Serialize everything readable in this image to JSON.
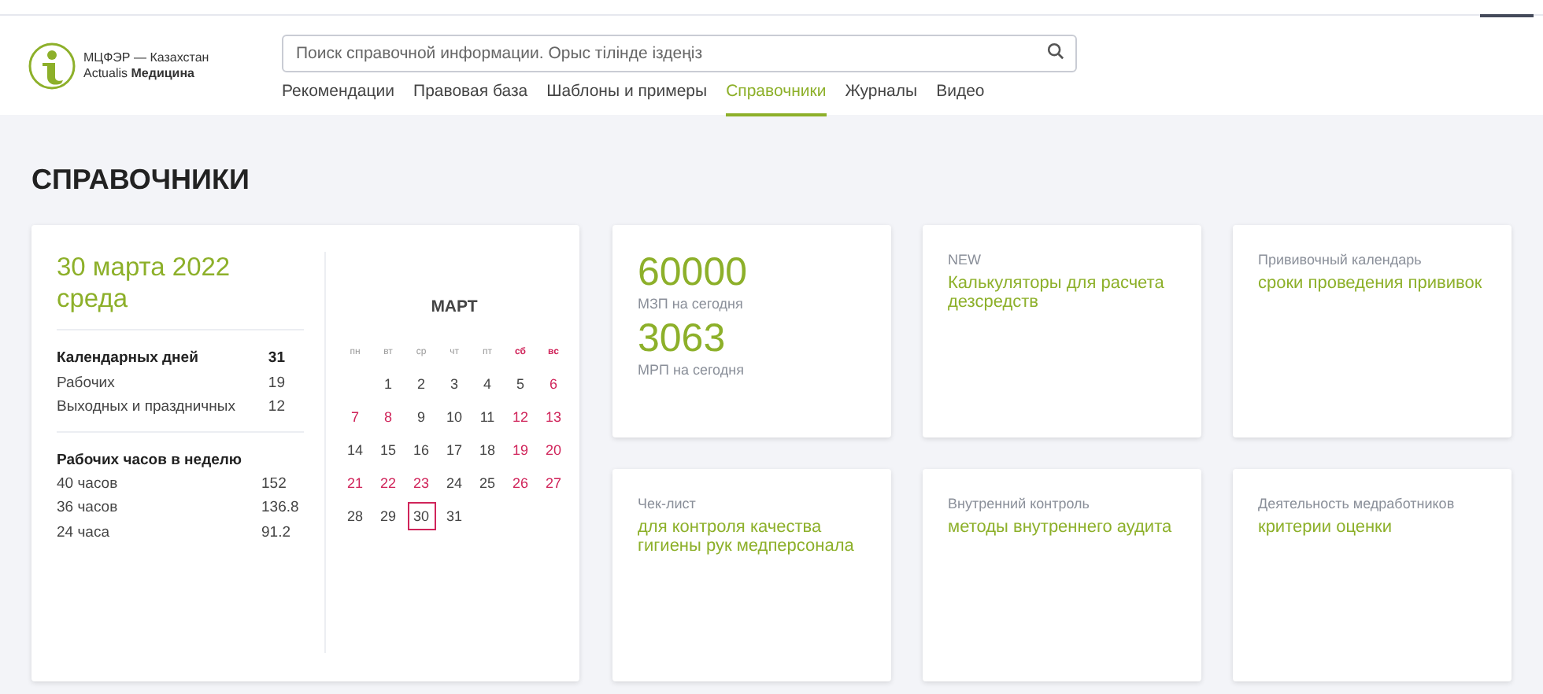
{
  "logo": {
    "line1": "МЦФЭР — Казахстан",
    "line2_prefix": "Actualis",
    "line2_bold": "Медицина"
  },
  "search": {
    "placeholder": "Поиск справочной информации. Орыс тілінде іздеңіз"
  },
  "nav": [
    {
      "label": "Рекомендации",
      "selected": false
    },
    {
      "label": "Правовая база",
      "selected": false
    },
    {
      "label": "Шаблоны и примеры",
      "selected": false
    },
    {
      "label": "Справочники",
      "selected": true
    },
    {
      "label": "Журналы",
      "selected": false
    },
    {
      "label": "Видео",
      "selected": false
    }
  ],
  "page_title": "СПРАВОЧНИКИ",
  "calendar_card": {
    "date": "30 марта 2022",
    "weekday": "среда",
    "days_stats": [
      {
        "label": "Календарных дней",
        "value": "31",
        "bold": true
      },
      {
        "label": "Рабочих",
        "value": "19",
        "bold": false
      },
      {
        "label": "Выходных и праздничных",
        "value": "12",
        "bold": false
      }
    ],
    "hours_title": "Рабочих часов в неделю",
    "hours_stats": [
      {
        "label": "40 часов",
        "value": "152"
      },
      {
        "label": "36 часов",
        "value": "136.8"
      },
      {
        "label": "24 часа",
        "value": "91.2"
      }
    ],
    "month": "МАРТ",
    "weekdays": [
      {
        "label": "пн",
        "holiday": false
      },
      {
        "label": "вт",
        "holiday": false
      },
      {
        "label": "ср",
        "holiday": false
      },
      {
        "label": "чт",
        "holiday": false
      },
      {
        "label": "пт",
        "holiday": false
      },
      {
        "label": "сб",
        "holiday": true
      },
      {
        "label": "вс",
        "holiday": true
      }
    ],
    "weeks": [
      [
        {
          "kind": "blank"
        },
        {
          "kind": "day",
          "day": "1",
          "holiday": false,
          "selected": false
        },
        {
          "kind": "day",
          "day": "2",
          "holiday": false,
          "selected": false
        },
        {
          "kind": "day",
          "day": "3",
          "holiday": false,
          "selected": false
        },
        {
          "kind": "day",
          "day": "4",
          "holiday": false,
          "selected": false
        },
        {
          "kind": "day",
          "day": "5",
          "holiday": false,
          "selected": false
        },
        {
          "kind": "day",
          "day": "6",
          "holiday": true,
          "selected": false
        }
      ],
      [
        {
          "kind": "day",
          "day": "7",
          "holiday": true,
          "selected": false
        },
        {
          "kind": "day",
          "day": "8",
          "holiday": true,
          "selected": false
        },
        {
          "kind": "day",
          "day": "9",
          "holiday": false,
          "selected": false
        },
        {
          "kind": "day",
          "day": "10",
          "holiday": false,
          "selected": false
        },
        {
          "kind": "day",
          "day": "11",
          "holiday": false,
          "selected": false
        },
        {
          "kind": "day",
          "day": "12",
          "holiday": true,
          "selected": false
        },
        {
          "kind": "day",
          "day": "13",
          "holiday": true,
          "selected": false
        }
      ],
      [
        {
          "kind": "day",
          "day": "14",
          "holiday": false,
          "selected": false
        },
        {
          "kind": "day",
          "day": "15",
          "holiday": false,
          "selected": false
        },
        {
          "kind": "day",
          "day": "16",
          "holiday": false,
          "selected": false
        },
        {
          "kind": "day",
          "day": "17",
          "holiday": false,
          "selected": false
        },
        {
          "kind": "day",
          "day": "18",
          "holiday": false,
          "selected": false
        },
        {
          "kind": "day",
          "day": "19",
          "holiday": true,
          "selected": false
        },
        {
          "kind": "day",
          "day": "20",
          "holiday": true,
          "selected": false
        }
      ],
      [
        {
          "kind": "day",
          "day": "21",
          "holiday": true,
          "selected": false
        },
        {
          "kind": "day",
          "day": "22",
          "holiday": true,
          "selected": false
        },
        {
          "kind": "day",
          "day": "23",
          "holiday": true,
          "selected": false
        },
        {
          "kind": "day",
          "day": "24",
          "holiday": false,
          "selected": false
        },
        {
          "kind": "day",
          "day": "25",
          "holiday": false,
          "selected": false
        },
        {
          "kind": "day",
          "day": "26",
          "holiday": true,
          "selected": false
        },
        {
          "kind": "day",
          "day": "27",
          "holiday": true,
          "selected": false
        }
      ],
      [
        {
          "kind": "day",
          "day": "28",
          "holiday": false,
          "selected": false
        },
        {
          "kind": "day",
          "day": "29",
          "holiday": false,
          "selected": false
        },
        {
          "kind": "day",
          "day": "30",
          "holiday": false,
          "selected": true
        },
        {
          "kind": "day",
          "day": "31",
          "holiday": false,
          "selected": false
        }
      ]
    ]
  },
  "cards": [
    {
      "kind": "figures",
      "figures": [
        {
          "value": "60000",
          "caption": "МЗП на сегодня"
        },
        {
          "value": "3063",
          "caption": "МРП на сегодня"
        }
      ]
    },
    {
      "kind": "link",
      "label": "NEW",
      "title": "Калькуляторы для расчета дезсредств"
    },
    {
      "kind": "link",
      "label": "Прививочный календарь",
      "title": "сроки проведения прививок"
    },
    {
      "kind": "link",
      "label": "Чек-лист",
      "title": "для контроля качества гигиены рук медперсонала"
    },
    {
      "kind": "link",
      "label": "Внутренний контроль",
      "title": "методы внутреннего аудита"
    },
    {
      "kind": "link",
      "label": "Деятельность медработников",
      "title": "критерии оценки"
    }
  ]
}
